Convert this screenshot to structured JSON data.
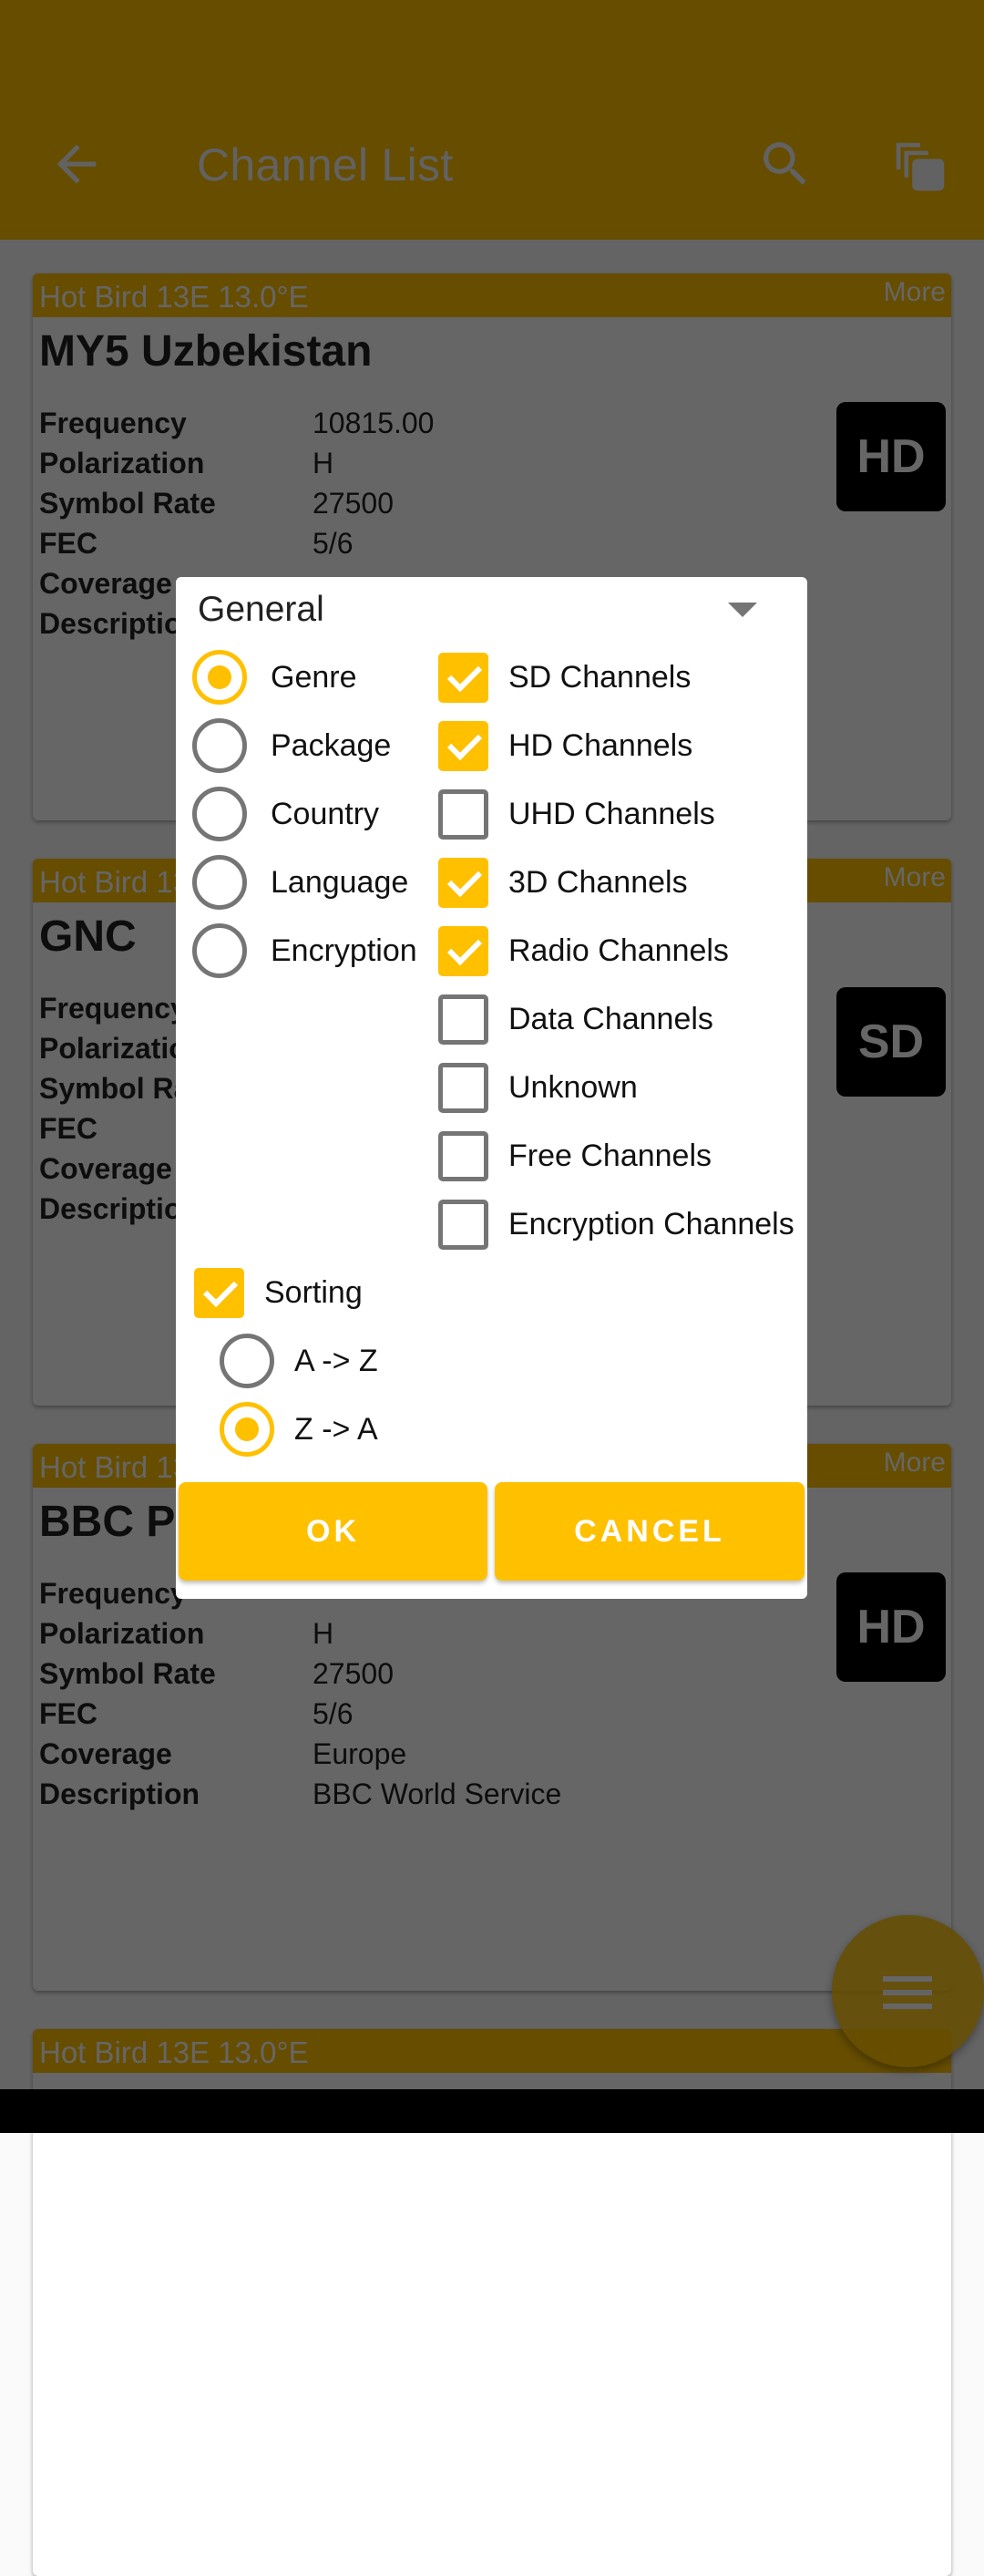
{
  "appbar": {
    "title": "Channel List",
    "icons": {
      "back": "arrow-back-icon",
      "search": "search-icon",
      "copy": "filter-copy-icon"
    }
  },
  "colors": {
    "accent": "#ffc000",
    "scrim": "rgba(0,0,0,0.6)",
    "unchecked": "#757575"
  },
  "cards": [
    {
      "satellite": "Hot Bird 13E 13.0°E",
      "more": "More",
      "name": "MY5 Uzbekistan",
      "badge": "HD",
      "rows": [
        {
          "label": "Frequency",
          "value": "10815.00"
        },
        {
          "label": "Polarization",
          "value": "H"
        },
        {
          "label": "Symbol Rate",
          "value": "27500"
        },
        {
          "label": "FEC",
          "value": "5/6"
        },
        {
          "label": "Coverage",
          "value": ""
        },
        {
          "label": "Description",
          "value": ""
        }
      ]
    },
    {
      "satellite": "Hot Bird 13E 13.0°E",
      "more": "More",
      "name": "GNC",
      "badge": "SD",
      "rows": [
        {
          "label": "Frequency",
          "value": ""
        },
        {
          "label": "Polarization",
          "value": ""
        },
        {
          "label": "Symbol Rate",
          "value": ""
        },
        {
          "label": "FEC",
          "value": ""
        },
        {
          "label": "Coverage",
          "value": ""
        },
        {
          "label": "Description",
          "value": ""
        }
      ]
    },
    {
      "satellite": "Hot Bird 13E 13.0°E",
      "more": "More",
      "name": "BBC Po",
      "badge": "HD",
      "rows": [
        {
          "label": "Frequency",
          "value": ""
        },
        {
          "label": "Polarization",
          "value": "H"
        },
        {
          "label": "Symbol Rate",
          "value": "27500"
        },
        {
          "label": "FEC",
          "value": "5/6"
        },
        {
          "label": "Coverage",
          "value": "Europe"
        },
        {
          "label": "Description",
          "value": "BBC World Service"
        }
      ]
    },
    {
      "satellite": "Hot Bird 13E 13.0°E"
    }
  ],
  "dialog": {
    "select_value": "General",
    "group_by": [
      {
        "label": "Genre",
        "selected": true
      },
      {
        "label": "Package",
        "selected": false
      },
      {
        "label": "Country",
        "selected": false
      },
      {
        "label": "Language",
        "selected": false
      },
      {
        "label": "Encryption",
        "selected": false
      }
    ],
    "filters": [
      {
        "label": "SD Channels",
        "checked": true
      },
      {
        "label": "HD Channels",
        "checked": true
      },
      {
        "label": "UHD Channels",
        "checked": false
      },
      {
        "label": "3D Channels",
        "checked": true
      },
      {
        "label": "Radio Channels",
        "checked": true
      },
      {
        "label": "Data Channels",
        "checked": false
      },
      {
        "label": "Unknown",
        "checked": false
      },
      {
        "label": "Free Channels",
        "checked": false
      },
      {
        "label": "Encryption Channels",
        "checked": false
      }
    ],
    "sorting": {
      "label": "Sorting",
      "checked": true
    },
    "sort_order": [
      {
        "label": "A -> Z",
        "selected": false
      },
      {
        "label": "Z -> A",
        "selected": true
      }
    ],
    "ok_label": "OK",
    "cancel_label": "CANCEL"
  },
  "fab": {
    "icon": "menu-icon"
  }
}
